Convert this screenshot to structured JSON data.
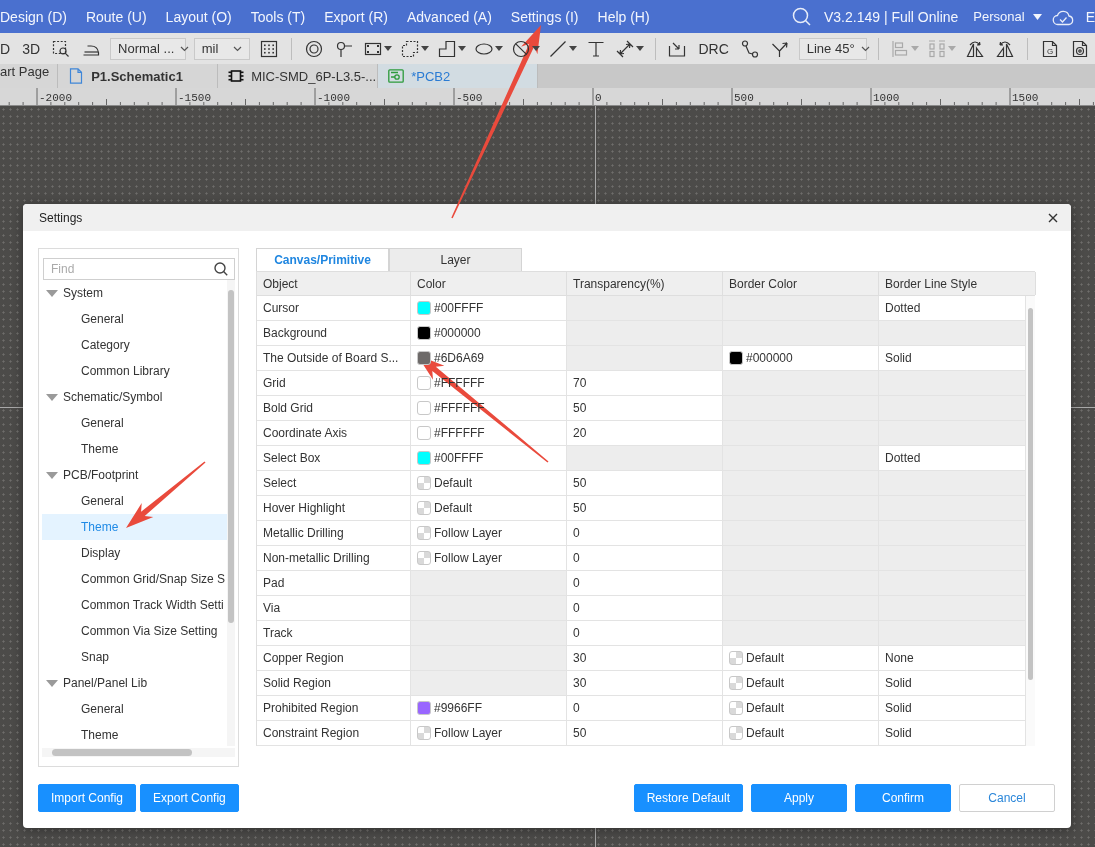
{
  "menu_bar": {
    "items": [
      "Design (D)",
      "Route (U)",
      "Layout (O)",
      "Tools (T)",
      "Export (R)",
      "Advanced (A)",
      "Settings (I)",
      "Help (H)"
    ],
    "version": "V3.2.149 | Full Online",
    "account": "Personal",
    "trailing_item": "E"
  },
  "toolbar": [
    {
      "kind": "text",
      "label": "D"
    },
    {
      "kind": "text",
      "label": "3D"
    },
    {
      "kind": "icon",
      "caret": false,
      "disabled": false
    },
    {
      "kind": "icon",
      "caret": false,
      "disabled": false
    },
    {
      "kind": "dropdown",
      "value": "Normal ..."
    },
    {
      "kind": "dropdown",
      "value": "mil"
    },
    {
      "kind": "icon",
      "caret": false,
      "disabled": false
    },
    {
      "kind": "separator"
    },
    {
      "kind": "icon",
      "caret": false,
      "disabled": false
    },
    {
      "kind": "icon",
      "caret": false,
      "disabled": false
    },
    {
      "kind": "icon",
      "caret": true,
      "disabled": false
    },
    {
      "kind": "icon",
      "caret": true,
      "disabled": false
    },
    {
      "kind": "icon",
      "caret": true,
      "disabled": false
    },
    {
      "kind": "icon",
      "caret": true,
      "disabled": false
    },
    {
      "kind": "icon",
      "caret": true,
      "disabled": false
    },
    {
      "kind": "icon",
      "caret": true,
      "disabled": false
    },
    {
      "kind": "icon",
      "caret": false,
      "disabled": false
    },
    {
      "kind": "icon",
      "caret": true,
      "disabled": false
    },
    {
      "kind": "separator"
    },
    {
      "kind": "icon",
      "caret": false,
      "disabled": false
    },
    {
      "kind": "text",
      "label": "DRC"
    },
    {
      "kind": "icon",
      "caret": false,
      "disabled": false
    },
    {
      "kind": "icon",
      "caret": false,
      "disabled": false
    },
    {
      "kind": "dropdown",
      "value": "Line 45°"
    },
    {
      "kind": "separator"
    },
    {
      "kind": "icon",
      "caret": true,
      "disabled": true
    },
    {
      "kind": "icon",
      "caret": true,
      "disabled": true
    },
    {
      "kind": "icon",
      "caret": false,
      "disabled": false
    },
    {
      "kind": "icon",
      "caret": false,
      "disabled": false
    },
    {
      "kind": "separator"
    },
    {
      "kind": "icon",
      "caret": false,
      "disabled": false,
      "label": "G"
    },
    {
      "kind": "icon",
      "caret": false,
      "disabled": false
    }
  ],
  "document_tabs": [
    {
      "label": "art Page",
      "kind": "page",
      "selected": false
    },
    {
      "label": "P1.Schematic1",
      "kind": "schematic",
      "selected": false
    },
    {
      "label": "MIC-SMD_6P-L3.5-...",
      "kind": "footprint",
      "selected": false
    },
    {
      "label": "*PCB2",
      "kind": "pcb",
      "selected": true
    }
  ],
  "ruler": {
    "labels": [
      "-2000",
      "-1500",
      "-1000",
      "-500",
      "0",
      "500",
      "1000",
      "1500"
    ]
  },
  "dialog": {
    "title": "Settings",
    "sidebar": {
      "search": {
        "placeholder": "Find"
      },
      "items": [
        {
          "label": "System",
          "expanded": true,
          "selected": false,
          "children": [
            {
              "label": "General",
              "selected": false
            },
            {
              "label": "Category",
              "selected": false
            },
            {
              "label": "Common Library",
              "selected": false
            }
          ]
        },
        {
          "label": "Schematic/Symbol",
          "expanded": true,
          "selected": false,
          "children": [
            {
              "label": "General",
              "selected": false
            },
            {
              "label": "Theme",
              "selected": false
            }
          ]
        },
        {
          "label": "PCB/Footprint",
          "expanded": true,
          "selected": false,
          "children": [
            {
              "label": "General",
              "selected": false
            },
            {
              "label": "Theme",
              "selected": true
            },
            {
              "label": "Display",
              "selected": false
            },
            {
              "label": "Common Grid/Snap Size S",
              "selected": false
            },
            {
              "label": "Common Track Width Setti",
              "selected": false
            },
            {
              "label": "Common Via Size Setting",
              "selected": false
            },
            {
              "label": "Snap",
              "selected": false
            }
          ]
        },
        {
          "label": "Panel/Panel Lib",
          "expanded": true,
          "selected": false,
          "children": [
            {
              "label": "General",
              "selected": false
            },
            {
              "label": "Theme",
              "selected": false
            }
          ]
        }
      ]
    },
    "tabs": [
      {
        "label": "Canvas/Primitive",
        "selected": true
      },
      {
        "label": "Layer",
        "selected": false
      }
    ],
    "table": {
      "columns": [
        "Object",
        "Color",
        "Transparency(%)",
        "Border Color",
        "Border Line Style"
      ],
      "rows": [
        {
          "object": "Cursor",
          "color": {
            "kind": "solid",
            "color": "#00ffff",
            "text": "#00FFFF",
            "disabled": false
          },
          "transparency": {
            "disabled": true
          },
          "border_color": {
            "disabled": true
          },
          "border_line_style": {
            "text": "Dotted",
            "disabled": false
          }
        },
        {
          "object": "Background",
          "color": {
            "kind": "solid",
            "color": "#000000",
            "text": "#000000",
            "disabled": false
          },
          "transparency": {
            "disabled": true
          },
          "border_color": {
            "disabled": true
          },
          "border_line_style": {
            "disabled": true
          }
        },
        {
          "object": "The Outside of Board S...",
          "color": {
            "kind": "solid",
            "color": "#6d6a69",
            "text": "#6D6A69",
            "disabled": false
          },
          "transparency": {
            "disabled": true
          },
          "border_color": {
            "kind": "solid",
            "color": "#000000",
            "text": "#000000",
            "disabled": false
          },
          "border_line_style": {
            "text": "Solid",
            "disabled": false
          }
        },
        {
          "object": "Grid",
          "color": {
            "kind": "solid",
            "color": "#ffffff",
            "text": "#FFFFFF",
            "disabled": false
          },
          "transparency": {
            "text": "70",
            "disabled": false
          },
          "border_color": {
            "disabled": true
          },
          "border_line_style": {
            "disabled": true
          }
        },
        {
          "object": "Bold Grid",
          "color": {
            "kind": "solid",
            "color": "#ffffff",
            "text": "#FFFFFF",
            "disabled": false
          },
          "transparency": {
            "text": "50",
            "disabled": false
          },
          "border_color": {
            "disabled": true
          },
          "border_line_style": {
            "disabled": true
          }
        },
        {
          "object": "Coordinate Axis",
          "color": {
            "kind": "solid",
            "color": "#ffffff",
            "text": "#FFFFFF",
            "disabled": false
          },
          "transparency": {
            "text": "20",
            "disabled": false
          },
          "border_color": {
            "disabled": true
          },
          "border_line_style": {
            "disabled": true
          }
        },
        {
          "object": "Select Box",
          "color": {
            "kind": "solid",
            "color": "#00ffff",
            "text": "#00FFFF",
            "disabled": false
          },
          "transparency": {
            "disabled": true
          },
          "border_color": {
            "disabled": true
          },
          "border_line_style": {
            "text": "Dotted",
            "disabled": false
          }
        },
        {
          "object": "Select",
          "color": {
            "kind": "checker",
            "text": "Default",
            "disabled": false
          },
          "transparency": {
            "text": "50",
            "disabled": false
          },
          "border_color": {
            "disabled": true
          },
          "border_line_style": {
            "disabled": true
          }
        },
        {
          "object": "Hover Highlight",
          "color": {
            "kind": "checker",
            "text": "Default",
            "disabled": false
          },
          "transparency": {
            "text": "50",
            "disabled": false
          },
          "border_color": {
            "disabled": true
          },
          "border_line_style": {
            "disabled": true
          }
        },
        {
          "object": "Metallic Drilling",
          "color": {
            "kind": "checker",
            "text": "Follow Layer",
            "disabled": false
          },
          "transparency": {
            "text": "0",
            "disabled": false
          },
          "border_color": {
            "disabled": true
          },
          "border_line_style": {
            "disabled": true
          }
        },
        {
          "object": "Non-metallic Drilling",
          "color": {
            "kind": "checker",
            "text": "Follow Layer",
            "disabled": false
          },
          "transparency": {
            "text": "0",
            "disabled": false
          },
          "border_color": {
            "disabled": true
          },
          "border_line_style": {
            "disabled": true
          }
        },
        {
          "object": "Pad",
          "color": {
            "disabled": true
          },
          "transparency": {
            "text": "0",
            "disabled": false
          },
          "border_color": {
            "disabled": true
          },
          "border_line_style": {
            "disabled": true
          }
        },
        {
          "object": "Via",
          "color": {
            "disabled": true
          },
          "transparency": {
            "text": "0",
            "disabled": false
          },
          "border_color": {
            "disabled": true
          },
          "border_line_style": {
            "disabled": true
          }
        },
        {
          "object": "Track",
          "color": {
            "disabled": true
          },
          "transparency": {
            "text": "0",
            "disabled": false
          },
          "border_color": {
            "disabled": true
          },
          "border_line_style": {
            "disabled": true
          }
        },
        {
          "object": "Copper Region",
          "color": {
            "disabled": true
          },
          "transparency": {
            "text": "30",
            "disabled": false
          },
          "border_color": {
            "kind": "checker",
            "text": "Default",
            "disabled": false
          },
          "border_line_style": {
            "text": "None",
            "disabled": false
          }
        },
        {
          "object": "Solid Region",
          "color": {
            "disabled": true
          },
          "transparency": {
            "text": "30",
            "disabled": false
          },
          "border_color": {
            "kind": "checker",
            "text": "Default",
            "disabled": false
          },
          "border_line_style": {
            "text": "Solid",
            "disabled": false
          }
        },
        {
          "object": "Prohibited Region",
          "color": {
            "kind": "solid",
            "color": "#9966ff",
            "text": "#9966FF",
            "disabled": false
          },
          "transparency": {
            "text": "0",
            "disabled": false
          },
          "border_color": {
            "kind": "checker",
            "text": "Default",
            "disabled": false
          },
          "border_line_style": {
            "text": "Solid",
            "disabled": false
          }
        },
        {
          "object": "Constraint Region",
          "color": {
            "kind": "checker",
            "text": "Follow Layer",
            "disabled": false
          },
          "transparency": {
            "text": "50",
            "disabled": false
          },
          "border_color": {
            "kind": "checker",
            "text": "Default",
            "disabled": false
          },
          "border_line_style": {
            "text": "Solid",
            "disabled": false
          }
        }
      ]
    },
    "left_buttons": [
      {
        "label": "Import Config",
        "kind": "primary"
      },
      {
        "label": "Export Config",
        "kind": "primary"
      }
    ],
    "right_buttons": [
      {
        "label": "Restore Default",
        "kind": "primary"
      },
      {
        "label": "Apply",
        "kind": "primary"
      },
      {
        "label": "Confirm",
        "kind": "primary"
      },
      {
        "label": "Cancel",
        "kind": "secondary"
      }
    ]
  },
  "annotations": [
    {
      "kind": "arrow"
    },
    {
      "kind": "arrow"
    },
    {
      "kind": "arrow"
    }
  ]
}
